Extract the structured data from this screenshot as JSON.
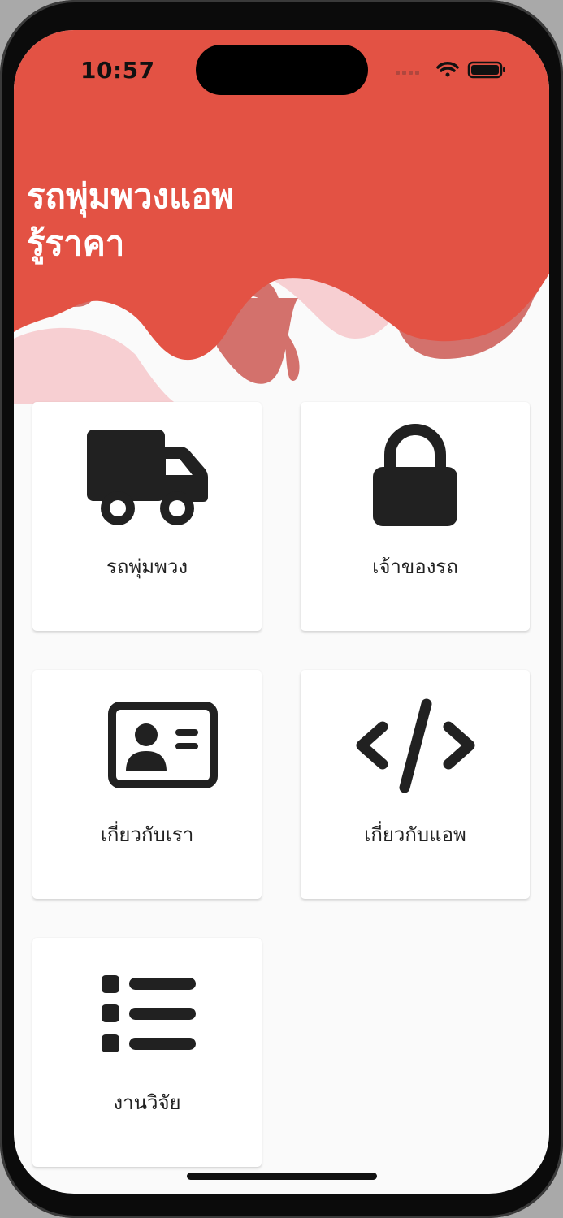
{
  "status_bar": {
    "time": "10:57",
    "icons": [
      "cellular-icon",
      "wifi-icon",
      "battery-icon"
    ]
  },
  "header": {
    "title_line1": "รถพุ่มพวงแอพ",
    "title_line2": "รู้ราคา"
  },
  "colors": {
    "header_red": "#e35244",
    "wave_dark": "#d3716c",
    "wave_light": "#f7cfd2",
    "background": "#fafafa",
    "icon": "#212121"
  },
  "menu": [
    {
      "label": "รถพุ่มพวง",
      "icon": "truck-icon"
    },
    {
      "label": "เจ้าของรถ",
      "icon": "lock-icon"
    },
    {
      "label": "เกี่ยวกับเรา",
      "icon": "id-card-icon"
    },
    {
      "label": "เกี่ยวกับแอพ",
      "icon": "code-icon"
    },
    {
      "label": "งานวิจัย",
      "icon": "list-icon"
    }
  ]
}
